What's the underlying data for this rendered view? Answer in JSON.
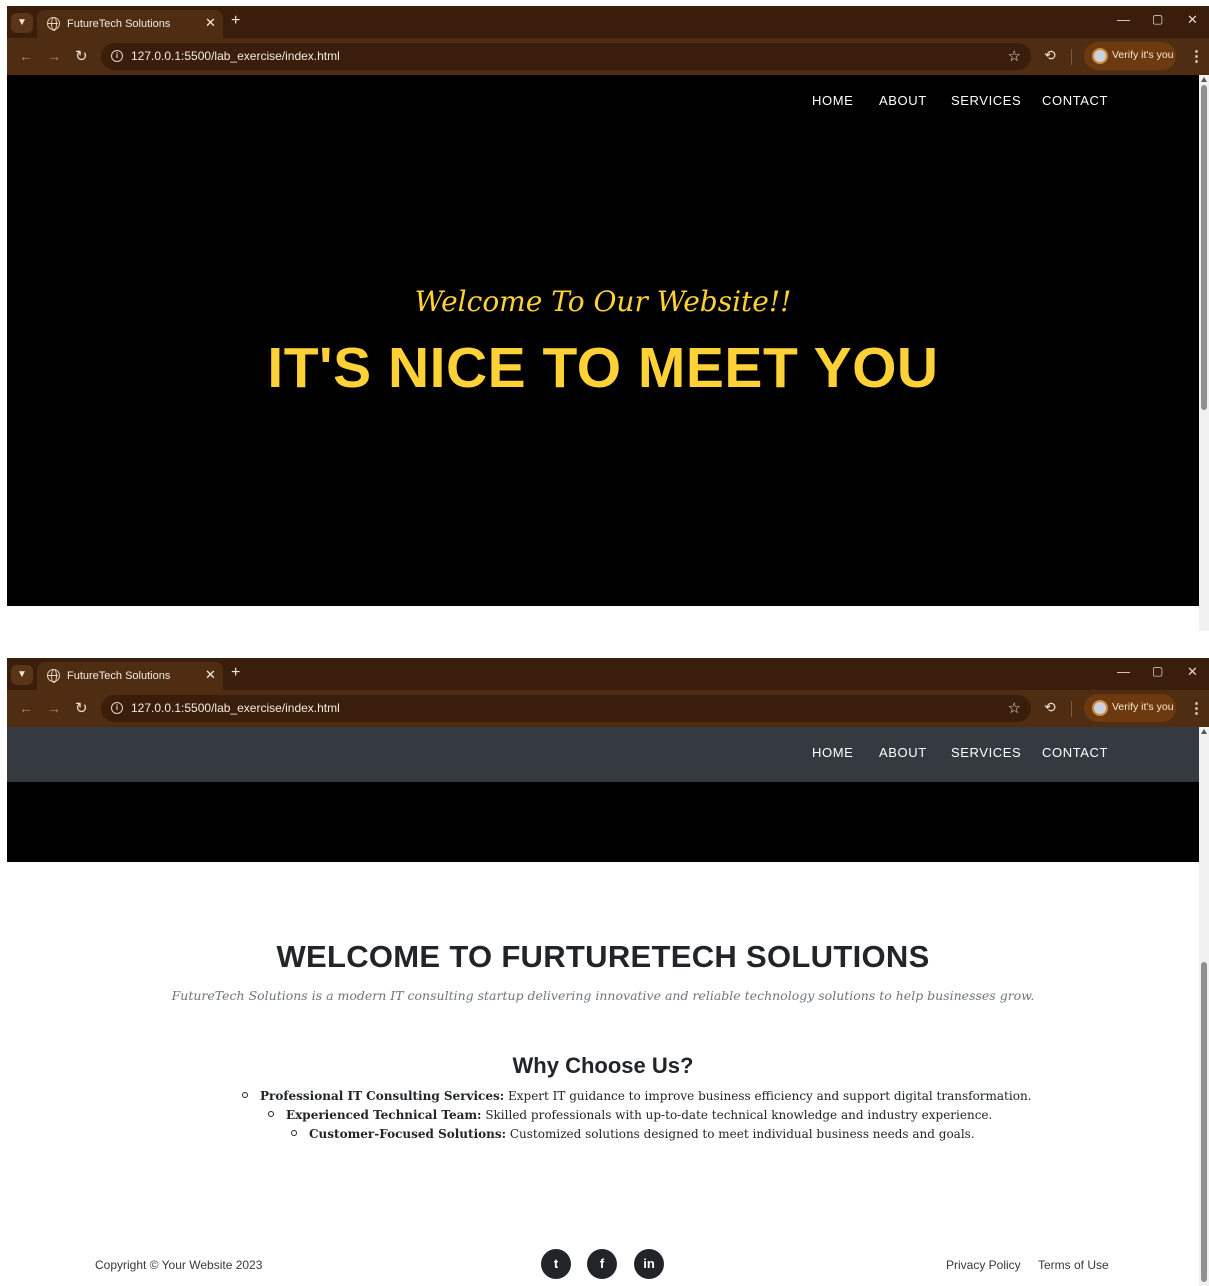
{
  "browser": {
    "tab_title": "FutureTech Solutions",
    "tab_close": "✕",
    "new_tab": "+",
    "url": "127.0.0.1:5500/lab_exercise/index.html",
    "verify_label": "Verify it's you",
    "minimize": "—",
    "maximize": "▢",
    "close": "✕"
  },
  "nav": {
    "items": [
      {
        "label": "HOME"
      },
      {
        "label": "ABOUT"
      },
      {
        "label": "SERVICES"
      },
      {
        "label": "CONTACT"
      }
    ]
  },
  "hero": {
    "subheading": "Welcome To Our Website!!",
    "heading": "IT'S NICE TO MEET YOU"
  },
  "about": {
    "title": "WELCOME TO FURTURETECH SOLUTIONS",
    "text": "FutureTech Solutions is a modern IT consulting startup delivering innovative and reliable technology solutions to help businesses grow."
  },
  "why": {
    "title": "Why Choose Us?",
    "features": [
      {
        "name": "Professional IT Consulting Services:",
        "desc": " Expert IT guidance to improve business efficiency and support digital transformation."
      },
      {
        "name": "Experienced Technical Team:",
        "desc": " Skilled professionals with up-to-date technical knowledge and industry experience."
      },
      {
        "name": "Customer-Focused Solutions:",
        "desc": " Customized solutions designed to meet individual business needs and goals."
      }
    ]
  },
  "footer": {
    "copyright": "Copyright © Your Website 2023",
    "social": {
      "twitter": "t",
      "facebook": "f",
      "linkedin": "in"
    },
    "privacy": "Privacy Policy",
    "terms": "Terms of Use"
  },
  "colors": {
    "accent": "#fed136",
    "chrome_dark": "#3a1e0b",
    "chrome_toolbar": "#4f2d13",
    "nav_bar": "#343a40"
  }
}
